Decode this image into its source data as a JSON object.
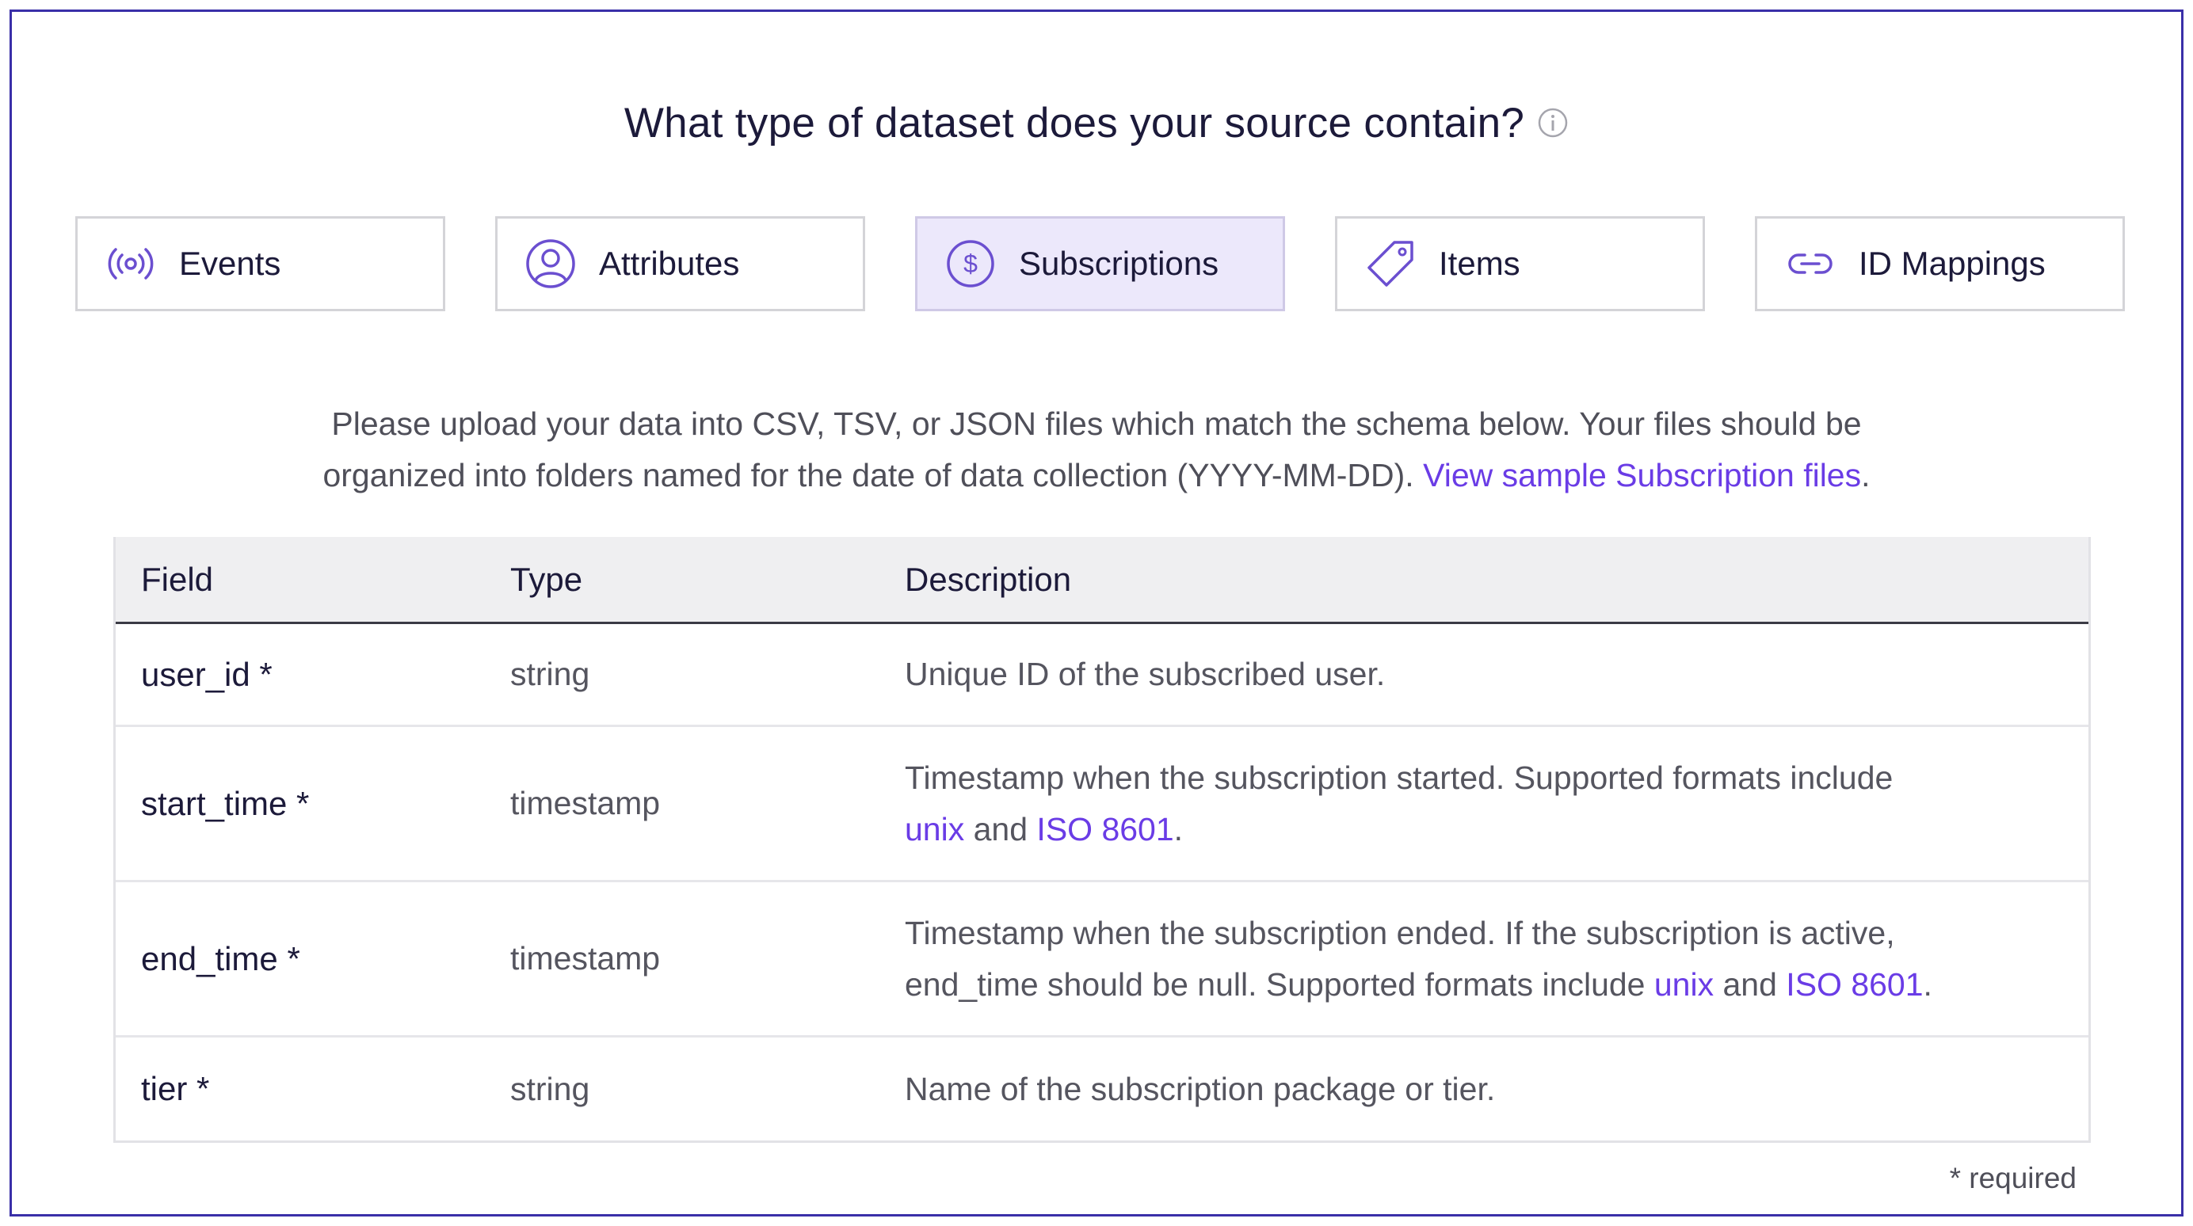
{
  "heading": {
    "title": "What type of dataset does your source contain?"
  },
  "tabs": [
    {
      "label": "Events",
      "icon": "broadcast-icon",
      "active": false
    },
    {
      "label": "Attributes",
      "icon": "user-circle-icon",
      "active": false
    },
    {
      "label": "Subscriptions",
      "icon": "dollar-circle-icon",
      "active": true
    },
    {
      "label": "Items",
      "icon": "tag-icon",
      "active": false
    },
    {
      "label": "ID Mappings",
      "icon": "link-icon",
      "active": false
    }
  ],
  "description": {
    "line1": "Please upload your data into CSV, TSV, or JSON files which match the schema below. Your files should be",
    "line2": "organized into folders named for the date of data collection (YYYY-MM-DD).",
    "link": "View sample Subscription files",
    "link_suffix": "."
  },
  "table": {
    "headers": {
      "field": "Field",
      "type": "Type",
      "description": "Description"
    },
    "rows": [
      {
        "field": "user_id *",
        "type": "string",
        "description": "Unique ID of the subscribed user."
      },
      {
        "field": "start_time *",
        "type": "timestamp",
        "description_line1": "Timestamp when the subscription started. Supported formats include",
        "link1": "unix",
        "mid": " and ",
        "link2": "ISO 8601",
        "end": "."
      },
      {
        "field": "end_time *",
        "type": "timestamp",
        "description_line1": "Timestamp when the subscription ended. If the subscription is active,",
        "description_line2": "end_time should be null. Supported formats include ",
        "link1": "unix",
        "mid": " and ",
        "link2": "ISO 8601",
        "end": "."
      },
      {
        "field": "tier *",
        "type": "string",
        "description": "Name of the subscription package or tier."
      }
    ]
  },
  "footer": {
    "required_note": "* required"
  },
  "colors": {
    "accent": "#6a3ce6",
    "active_tab_bg": "#ece8fb",
    "frame_border": "#3a2fa8",
    "icon": "#6b4fd0"
  }
}
